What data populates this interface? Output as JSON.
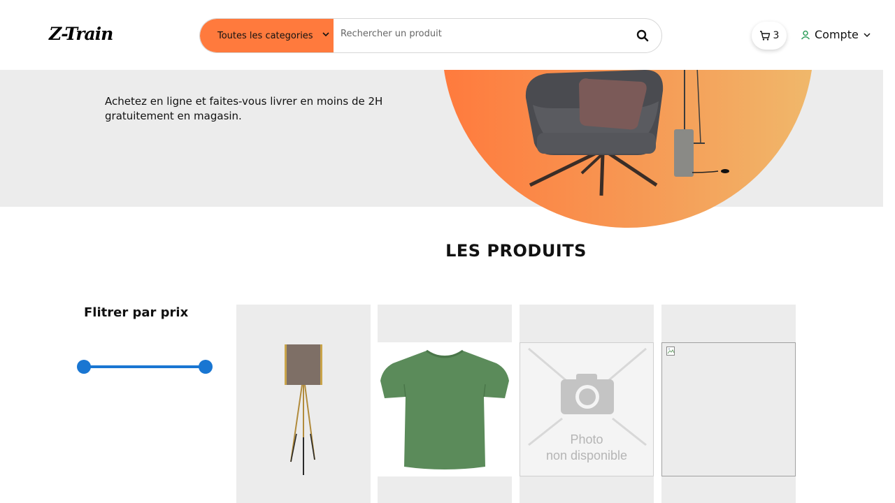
{
  "header": {
    "logo": "Z-Train",
    "category_select": "Toutes les categories",
    "search_placeholder": "Rechercher un produit",
    "cart_count": "3",
    "account_label": "Compte"
  },
  "hero": {
    "subtitle": "Achetez en ligne et faites-vous livrer en moins de 2H gratuitement en magasin."
  },
  "products": {
    "section_title": "LES PRODUITS",
    "filter_title": "Flitrer par prix",
    "price_range_fraction": [
      0,
      1
    ],
    "cards": [
      {
        "image": "floor-lamp"
      },
      {
        "image": "green-tshirt"
      },
      {
        "image": "photo-unavailable",
        "placeholder_line1": "Photo",
        "placeholder_line2": "non disponible"
      },
      {
        "image": "broken-image"
      }
    ]
  },
  "colors": {
    "accent": "#ff7a3d",
    "slider": "#1976d2",
    "hero_bg": "#ececec",
    "account_icon": "#2e9e5b"
  }
}
